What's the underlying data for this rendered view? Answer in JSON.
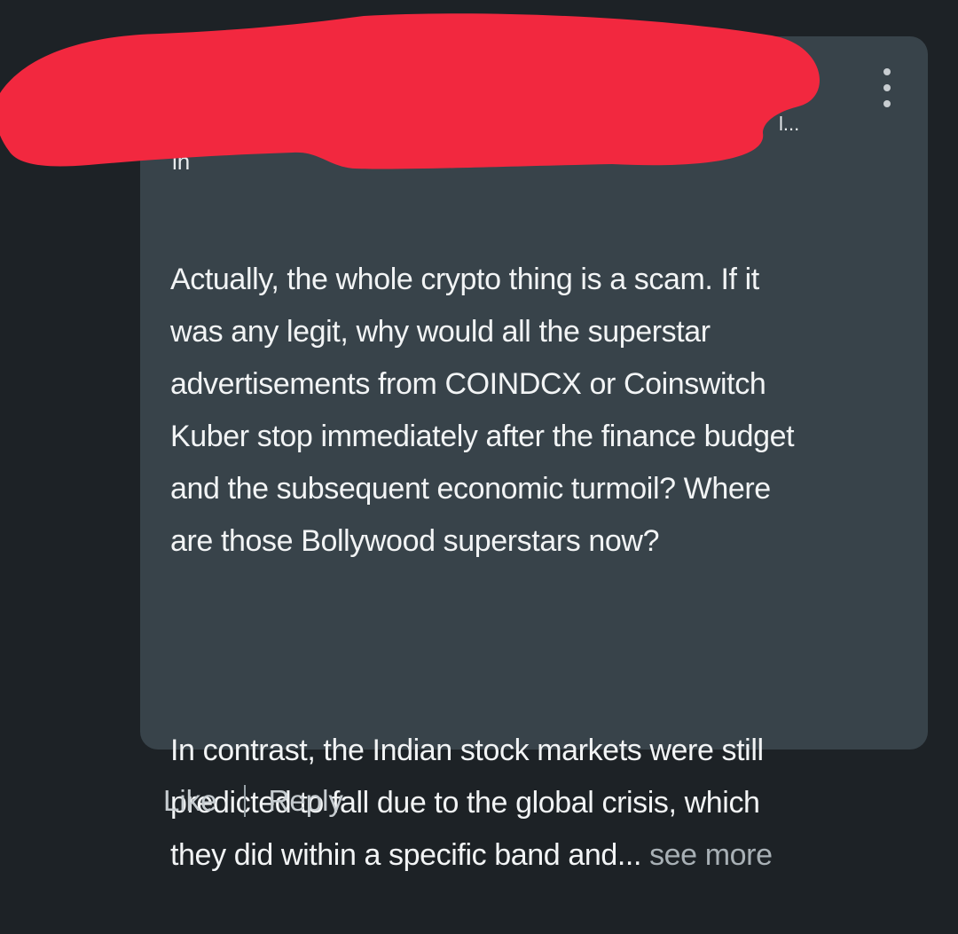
{
  "comment": {
    "author_headline_tail": "l...",
    "author_subline": "ih",
    "body_paragraph_1": "Actually, the whole crypto thing is a scam. If it\nwas any legit, why would all the superstar\nadvertisements from COINDCX or Coinswitch\nKuber stop immediately after the finance budget\nand the subsequent economic turmoil?  Where\nare those Bollywood superstars now?",
    "body_paragraph_2": "In contrast, the Indian stock markets were still\npredicted to fall due to the global crisis, which\nthey did within a specific band and...",
    "see_more_label": " see more",
    "more_options_icon": "more-vertical-icon"
  },
  "actions": {
    "like_label": "Like",
    "reply_label": "Reply"
  },
  "colors": {
    "background": "#1d2226",
    "bubble": "#38434a",
    "redaction": "#f2283f",
    "text": "#f2f4f5",
    "muted_text": "#a8b0b5"
  }
}
